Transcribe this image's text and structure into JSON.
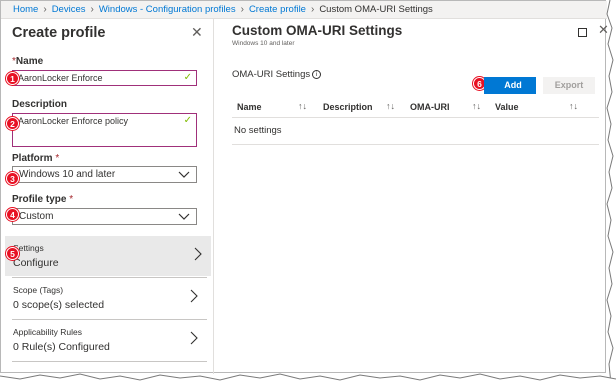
{
  "breadcrumb": [
    "Home",
    "Devices",
    "Windows - Configuration profiles",
    "Create profile",
    "Custom OMA-URI Settings"
  ],
  "left": {
    "title": "Create profile",
    "name_label": "Name",
    "name_value": "AaronLocker Enforce",
    "description_label": "Description",
    "description_value": "AaronLocker Enforce policy",
    "platform_label": "Platform",
    "platform_value": "Windows 10 and later",
    "profile_type_label": "Profile type",
    "profile_type_value": "Custom",
    "settings_title": "Settings",
    "settings_value": "Configure",
    "scope_title": "Scope (Tags)",
    "scope_value": "0 scope(s) selected",
    "applicability_title": "Applicability Rules",
    "applicability_value": "0 Rule(s) Configured",
    "required_mark": "*"
  },
  "badges": [
    "1",
    "2",
    "3",
    "4",
    "5",
    "6"
  ],
  "right": {
    "title": "Custom OMA-URI Settings",
    "subtitle": "Windows 10 and later",
    "section_label": "OMA-URI Settings",
    "add_label": "Add",
    "export_label": "Export",
    "columns": [
      "Name",
      "Description",
      "OMA-URI",
      "Value"
    ],
    "sort_glyph": "↑↓",
    "empty_text": "No settings"
  },
  "colors": {
    "accent": "#0078d4",
    "badge": "#e81123",
    "highlight_border": "#a0307a",
    "valid_check": "#7fba00"
  },
  "icons": [
    "close-icon",
    "check-icon",
    "chevron-down-icon",
    "chevron-right-icon",
    "info-icon",
    "maximize-icon"
  ]
}
